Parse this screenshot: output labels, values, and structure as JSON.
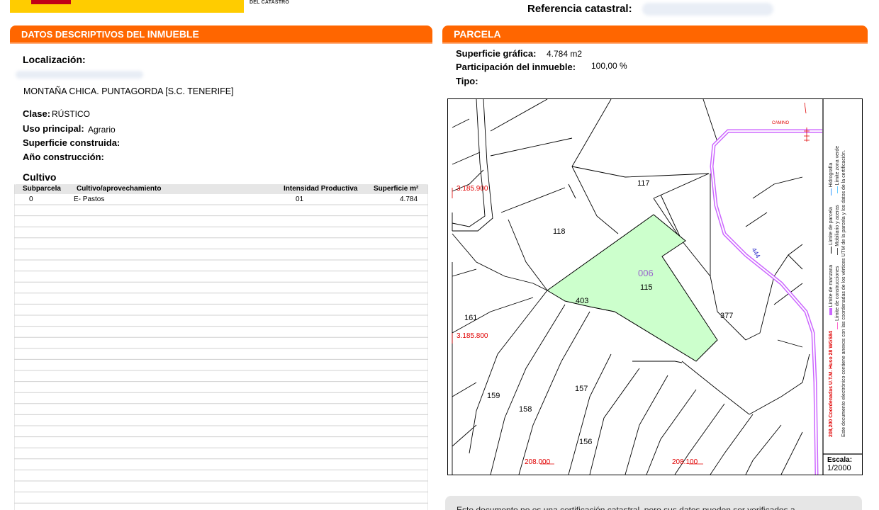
{
  "header": {
    "logo_text": "DEL CATASTRO",
    "ref_label": "Referencia catastral:"
  },
  "left_section": {
    "title_prefix": "DATOS DESCRIPTIVOS DEL ",
    "title_emph": "INMUEBLE",
    "localizacion_label": "Localización:",
    "address": "MONTAÑA CHICA. PUNTAGORDA [S.C. TENERIFE]",
    "clase_label": "Clase:",
    "clase_value": "RÚSTICO",
    "uso_label": "Uso principal:",
    "uso_value": "Agrario",
    "superficie_label": "Superficie construida:",
    "anio_label": "Año construcción:"
  },
  "cultivo": {
    "title": "Cultivo",
    "columns": [
      "Subparcela",
      "Cultivo/aprovechamiento",
      "Intensidad Productiva",
      "Superficie m²"
    ],
    "rows": [
      {
        "subparcela": "0",
        "cultivo": "E- Pastos",
        "intensidad": "01",
        "superficie": "4.784"
      }
    ]
  },
  "right_section": {
    "title": "PARCELA",
    "superficie_grafica_label": "Superficie gráfica:",
    "superficie_grafica_value": "4.784 m2",
    "participacion_label": "Participación del inmueble:",
    "participacion_value": "100,00 %",
    "tipo_label": "Tipo:"
  },
  "map": {
    "coord_labels": [
      "3.185.900",
      "3.185.800",
      "208.000",
      "208.100"
    ],
    "parcel_labels": [
      "117",
      "118",
      "115",
      "403",
      "161",
      "377",
      "159",
      "157",
      "158",
      "156"
    ],
    "highlight_code": "006",
    "road_labels": [
      "CAMINO",
      "444"
    ],
    "legend": [
      "Límite de manzana",
      "Límite de parcela",
      "Hidrografía",
      "Límite de construcciones",
      "Mobiliario y aceras",
      "Límite zona verde"
    ],
    "coord_system": "208,200 Coordenadas U.T.M. Huso 28 WGS84",
    "electronic_note": "Este documento electrónico contiene anexos con las coordenadas de los vértices UTM de la parcela y los datos de la certificación.",
    "scale_label": "Escala:",
    "scale_value": "1/2000"
  },
  "notice": {
    "text": "Este documento no es una certificación catastral, pero sus datos pueden ser verificados a"
  },
  "colors": {
    "accent": "#ff6600",
    "highlight_fill": "#ccffcc",
    "coord_red": "#e00000",
    "road_purple": "#cc66ff"
  }
}
